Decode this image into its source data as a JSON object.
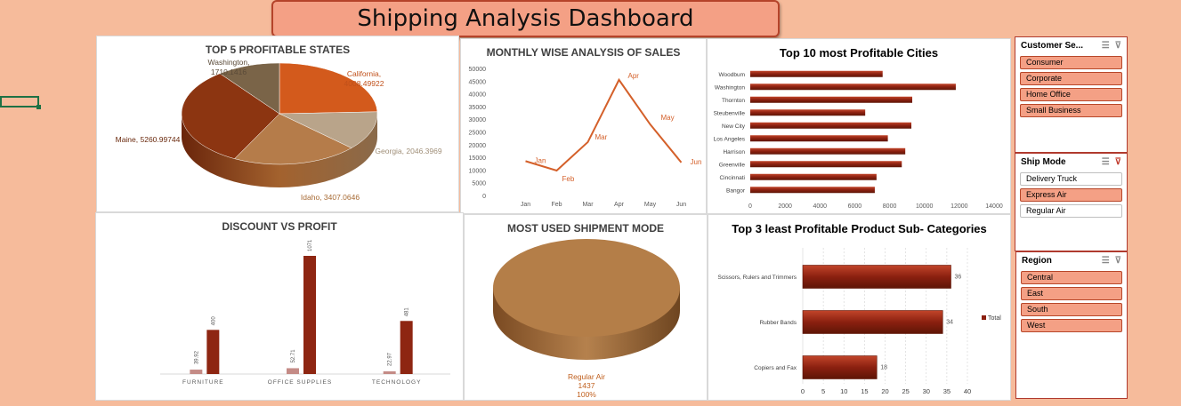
{
  "dashboard": {
    "title": "Shipping Analysis Dashboard"
  },
  "colors": {
    "accent": "#f4a085",
    "bar_dark": "#8b2010",
    "line": "#d4602a",
    "background": "#f6bb9b"
  },
  "charts": {
    "states": {
      "title": "TOP 5 PROFITABLE STATES"
    },
    "monthly": {
      "title": "MONTHLY WISE ANALYSIS OF SALES"
    },
    "cities": {
      "title": "Top 10 most Profitable Cities"
    },
    "discount": {
      "title": "DISCOUNT VS PROFIT"
    },
    "shipment": {
      "title": "MOST USED SHIPMENT MODE"
    },
    "subcat": {
      "title": "Top 3 least Profitable Product Sub- Categories"
    }
  },
  "chart_data": [
    {
      "type": "pie",
      "title": "TOP 5 PROFITABLE STATES",
      "labels": [
        "California",
        "Georgia",
        "Idaho",
        "Maine",
        "Washington"
      ],
      "values": [
        4008.49922,
        2046.3969,
        3407.0646,
        5260.99744,
        1710.1416
      ],
      "data_labels": [
        "California, 4008.49922",
        "Georgia, 2046.3969",
        "Idaho, 3407.0646",
        "Maine, 5260.99744",
        "Washington, 1710.1416"
      ],
      "colors": [
        "#d35a1c",
        "#b9a48a",
        "#b57c4a",
        "#8c3511",
        "#7a6448"
      ]
    },
    {
      "type": "line",
      "title": "MONTHLY WISE ANALYSIS OF SALES",
      "categories": [
        "Jan",
        "Feb",
        "Mar",
        "Apr",
        "May",
        "Jun"
      ],
      "values": [
        13500,
        9800,
        21000,
        45500,
        28000,
        13000
      ],
      "ylim": [
        0,
        50000
      ],
      "yticks": [
        "0",
        "5000",
        "10000",
        "15000",
        "20000",
        "25000",
        "30000",
        "35000",
        "40000",
        "45000",
        "50000"
      ]
    },
    {
      "type": "bar",
      "orientation": "horizontal",
      "title": "Top 10 most Profitable Cities",
      "categories": [
        "Woodbum",
        "Washington",
        "Thornton",
        "Steubenville",
        "New City",
        "Los Angeles",
        "Harrison",
        "Greenville",
        "Cincinnati",
        "Bangor"
      ],
      "values": [
        7600,
        11800,
        9300,
        6600,
        9250,
        7900,
        8900,
        8700,
        7250,
        7150
      ],
      "xlim": [
        0,
        14000
      ],
      "xticks": [
        "0",
        "2000",
        "4000",
        "6000",
        "8000",
        "10000",
        "12000",
        "14000"
      ]
    },
    {
      "type": "bar",
      "title": "DISCOUNT VS PROFIT",
      "categories": [
        "FURNITURE",
        "OFFICE SUPPLIES",
        "TECHNOLOGY"
      ],
      "series": [
        {
          "values": [
            39.92,
            52.71,
            22.97
          ],
          "labels": [
            "39.92",
            "52.71",
            "22.97"
          ]
        },
        {
          "values": [
            400,
            1071,
            481
          ],
          "labels": [
            "400",
            "1071",
            "481"
          ]
        }
      ]
    },
    {
      "type": "pie",
      "title": "MOST USED SHIPMENT MODE",
      "labels": [
        "Regular Air"
      ],
      "values": [
        1437
      ],
      "data_label_lines": [
        "Regular Air",
        "1437",
        "100%"
      ]
    },
    {
      "type": "bar",
      "orientation": "horizontal",
      "title": "Top 3 least Profitable Product Sub- Categories",
      "categories": [
        "Scissors, Rulers and Trimmers",
        "Rubber Bands",
        "Copiers and Fax"
      ],
      "values": [
        36,
        34,
        18
      ],
      "xlim": [
        0,
        40
      ],
      "xticks": [
        "0",
        "5",
        "10",
        "15",
        "20",
        "25",
        "30",
        "35",
        "40"
      ],
      "legend": "Total"
    }
  ],
  "slicers": {
    "customer": {
      "title": "Customer Se...",
      "items": [
        "Consumer",
        "Corporate",
        "Home Office",
        "Small Business"
      ]
    },
    "shipmode": {
      "title": "Ship Mode",
      "items": [
        "Delivery Truck",
        "Express Air",
        "Regular Air"
      ]
    },
    "region": {
      "title": "Region",
      "items": [
        "Central",
        "East",
        "South",
        "West"
      ]
    }
  },
  "icons": {
    "multiselect": "multi-select-icon",
    "clear": "clear-filter-icon"
  }
}
